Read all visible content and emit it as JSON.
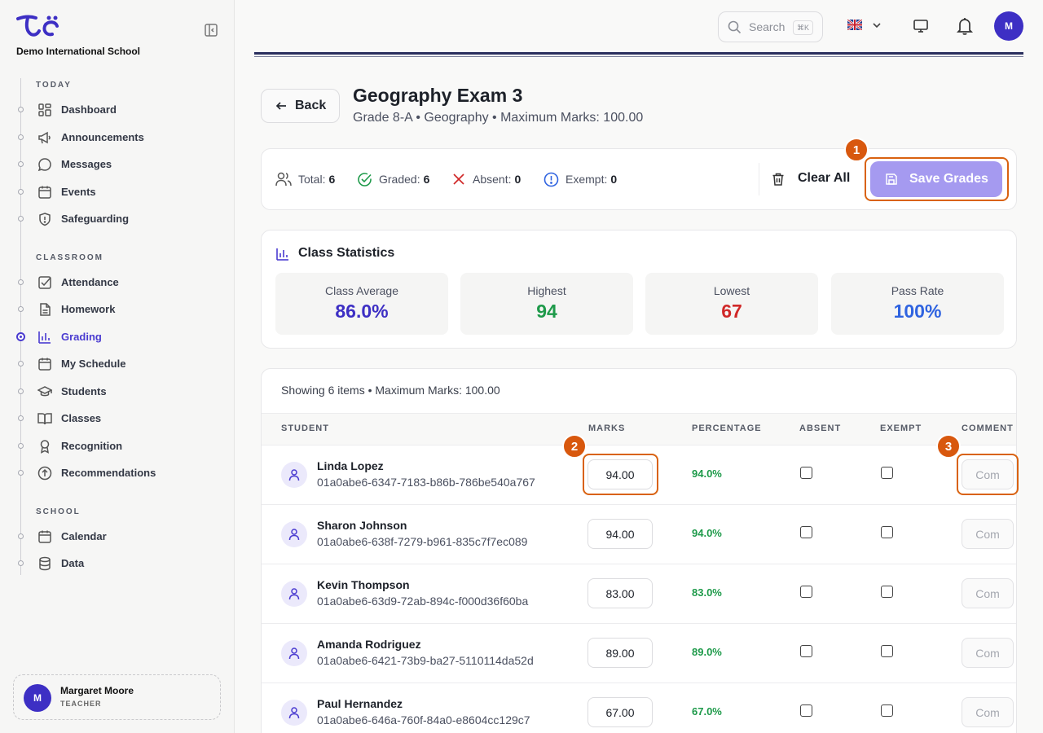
{
  "app": {
    "school_name": "Demo International School"
  },
  "sidebar": {
    "sections": {
      "today": "TODAY",
      "classroom": "CLASSROOM",
      "school": "SCHOOL"
    },
    "items": [
      {
        "label": "Dashboard",
        "icon": "dashboard-icon"
      },
      {
        "label": "Announcements",
        "icon": "megaphone-icon"
      },
      {
        "label": "Messages",
        "icon": "chat-icon"
      },
      {
        "label": "Events",
        "icon": "calendar-icon"
      },
      {
        "label": "Safeguarding",
        "icon": "shield-icon"
      },
      {
        "label": "Attendance",
        "icon": "checkbox-icon"
      },
      {
        "label": "Homework",
        "icon": "document-icon"
      },
      {
        "label": "Grading",
        "icon": "bar-chart-icon",
        "active": true
      },
      {
        "label": "My Schedule",
        "icon": "calendar-icon"
      },
      {
        "label": "Students",
        "icon": "graduation-cap-icon"
      },
      {
        "label": "Classes",
        "icon": "book-icon"
      },
      {
        "label": "Recognition",
        "icon": "award-icon"
      },
      {
        "label": "Recommendations",
        "icon": "arrow-up-circle-icon"
      },
      {
        "label": "Calendar",
        "icon": "calendar-icon"
      },
      {
        "label": "Data",
        "icon": "database-icon"
      }
    ],
    "user": {
      "initial": "M",
      "name": "Margaret Moore",
      "role": "TEACHER"
    }
  },
  "topbar": {
    "search_placeholder": "Search",
    "search_shortcut": "⌘K",
    "avatar_initial": "M"
  },
  "header": {
    "back_label": "Back",
    "title": "Geography Exam 3",
    "subtitle": "Grade 8-A • Geography • Maximum Marks: 100.00"
  },
  "summary": {
    "total_label": "Total:",
    "total_value": "6",
    "graded_label": "Graded:",
    "graded_value": "6",
    "absent_label": "Absent:",
    "absent_value": "0",
    "exempt_label": "Exempt:",
    "exempt_value": "0",
    "clear_label": "Clear All",
    "save_label": "Save Grades"
  },
  "callouts": [
    "1",
    "2",
    "3"
  ],
  "class_stats": {
    "title": "Class Statistics",
    "tiles": [
      {
        "label": "Class Average",
        "value": "86.0%",
        "color": "#3d2fc4"
      },
      {
        "label": "Highest",
        "value": "94",
        "color": "#1e9a4a"
      },
      {
        "label": "Lowest",
        "value": "67",
        "color": "#d02828"
      },
      {
        "label": "Pass Rate",
        "value": "100%",
        "color": "#2f63e0"
      }
    ]
  },
  "table": {
    "showing": "Showing 6 items • Maximum Marks: 100.00",
    "headers": {
      "student": "STUDENT",
      "marks": "MARKS",
      "percentage": "PERCENTAGE",
      "absent": "ABSENT",
      "exempt": "EXEMPT",
      "comment": "COMMENT"
    },
    "comment_placeholder": "Com",
    "rows": [
      {
        "name": "Linda Lopez",
        "id": "01a0abe6-6347-7183-b86b-786be540a767",
        "marks": "94.00",
        "percentage": "94.0%"
      },
      {
        "name": "Sharon Johnson",
        "id": "01a0abe6-638f-7279-b961-835c7f7ec089",
        "marks": "94.00",
        "percentage": "94.0%"
      },
      {
        "name": "Kevin Thompson",
        "id": "01a0abe6-63d9-72ab-894c-f000d36f60ba",
        "marks": "83.00",
        "percentage": "83.0%"
      },
      {
        "name": "Amanda Rodriguez",
        "id": "01a0abe6-6421-73b9-ba27-5110114da52d",
        "marks": "89.00",
        "percentage": "89.0%"
      },
      {
        "name": "Paul Hernandez",
        "id": "01a0abe6-646a-760f-84a0-e8604cc129c7",
        "marks": "67.00",
        "percentage": "67.0%"
      }
    ]
  }
}
